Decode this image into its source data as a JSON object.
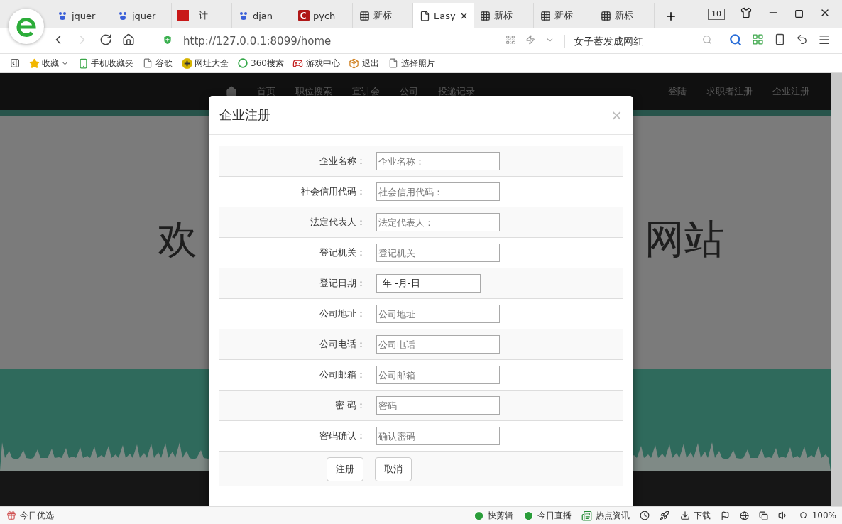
{
  "browser": {
    "tabs": [
      {
        "label": "jquer",
        "kind": "paw",
        "selected": false
      },
      {
        "label": "jquer",
        "kind": "paw",
        "selected": false
      },
      {
        "label": "- 计",
        "kind": "flag",
        "selected": false
      },
      {
        "label": "djan",
        "kind": "paw",
        "selected": false
      },
      {
        "label": "pych",
        "kind": "letter",
        "selected": false
      },
      {
        "label": "新标",
        "kind": "grid",
        "selected": false
      },
      {
        "label": "Easy",
        "kind": "page",
        "selected": true
      },
      {
        "label": "新标",
        "kind": "grid",
        "selected": false
      },
      {
        "label": "新标",
        "kind": "grid",
        "selected": false
      },
      {
        "label": "新标",
        "kind": "grid",
        "selected": false
      }
    ],
    "tab_count": "10",
    "forward": {
      "disabled": true
    },
    "url": "http://127.0.0.1:8099/home",
    "search": {
      "placeholder": "女子蓄发成网红"
    },
    "bookmarks": [
      {
        "label": "收藏",
        "kind": "star"
      },
      {
        "label": "手机收藏夹",
        "kind": "phone"
      },
      {
        "label": "谷歌",
        "kind": "page"
      },
      {
        "label": "网址大全",
        "kind": "plus"
      },
      {
        "label": "360搜索",
        "kind": "ring"
      },
      {
        "label": "游戏中心",
        "kind": "game"
      },
      {
        "label": "退出",
        "kind": "box"
      },
      {
        "label": "选择照片",
        "kind": "page"
      }
    ],
    "status_bar": {
      "left": "今日优选",
      "items": [
        {
          "label": "快剪辑",
          "kind": "play"
        },
        {
          "label": "今日直播",
          "kind": "play"
        },
        {
          "label": "热点资讯",
          "kind": "news"
        },
        {
          "label": "下载",
          "kind": "download"
        }
      ],
      "zoom": "100%"
    }
  },
  "page": {
    "nav": {
      "left": [
        "首页",
        "职位搜索",
        "宣讲会",
        "公司",
        "投递记录"
      ],
      "right": [
        "登陆",
        "求职者注册",
        "企业注册"
      ]
    },
    "hero": {
      "left": "欢",
      "right": "网站"
    }
  },
  "modal": {
    "title": "企业注册",
    "close": "×",
    "fields": [
      {
        "label": "企业名称：",
        "kind": "text",
        "placeholder": "企业名称："
      },
      {
        "label": "社会信用代码：",
        "kind": "text",
        "placeholder": "社会信用代码："
      },
      {
        "label": "法定代表人：",
        "kind": "text",
        "placeholder": "法定代表人："
      },
      {
        "label": "登记机关：",
        "kind": "text",
        "placeholder": "登记机关"
      },
      {
        "label": "登记日期：",
        "kind": "date",
        "value": "年 -月-日"
      },
      {
        "label": "公司地址：",
        "kind": "text",
        "placeholder": "公司地址"
      },
      {
        "label": "公司电话：",
        "kind": "text",
        "placeholder": "公司电话"
      },
      {
        "label": "公司邮箱：",
        "kind": "text",
        "placeholder": "公司邮箱"
      },
      {
        "label": "密 码：",
        "kind": "text",
        "placeholder": "密码"
      },
      {
        "label": "密码确认：",
        "kind": "text",
        "placeholder": "确认密码"
      }
    ],
    "buttons": [
      "注册",
      "取消"
    ]
  }
}
